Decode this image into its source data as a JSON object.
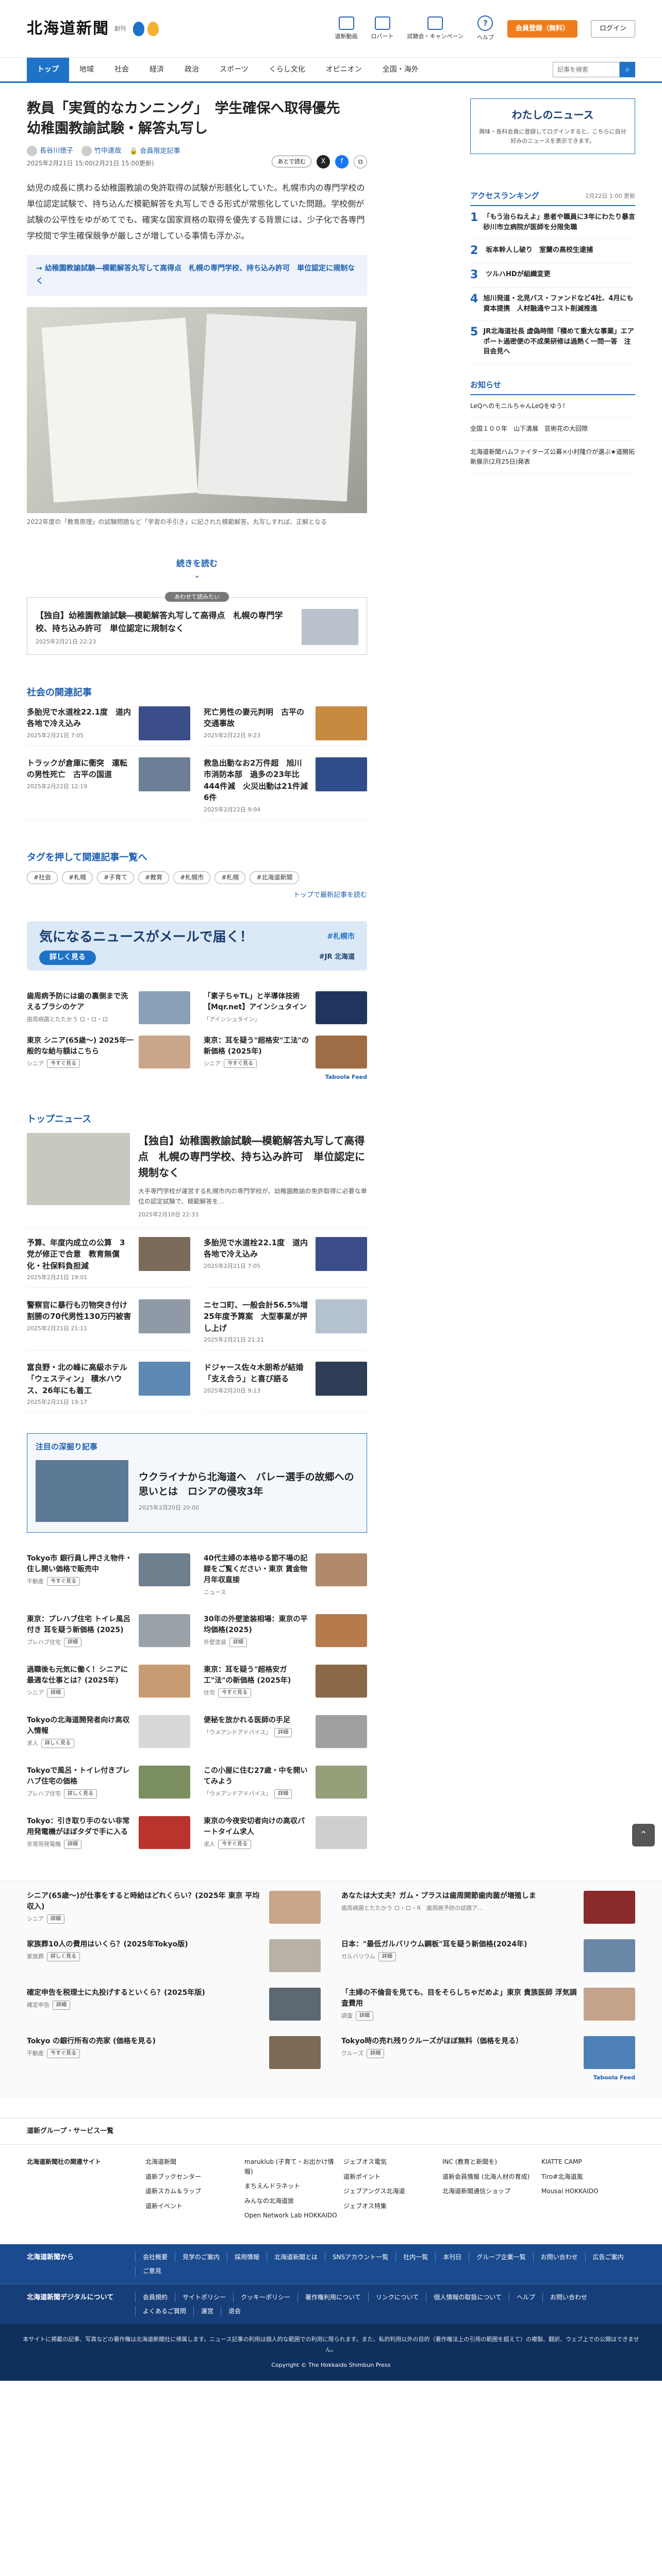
{
  "header": {
    "logo": "北海道新聞",
    "logo_sub": "創刊",
    "icons": [
      "道新動画",
      "ロバート",
      "試聴会・キャンペーン",
      "ヘルプ"
    ],
    "register": "会員登録（無料）",
    "login": "ログイン"
  },
  "nav": {
    "items": [
      "トップ",
      "地域",
      "社会",
      "経済",
      "政治",
      "スポーツ",
      "くらし文化",
      "オピニオン",
      "全国・海外"
    ],
    "search_placeholder": "記事を検索"
  },
  "article": {
    "title": "教員「実質的なカンニング」　学生確保へ取得優先　幼稚園教諭試験・解答丸写し",
    "authors": [
      "長谷川徳子",
      "竹中達哉"
    ],
    "dept": "会員限定記事",
    "dates": "2025年2月21日 15:00(2月21日 15:00更新)",
    "share_label": "あとで読む",
    "lead": "幼児の成長に携わる幼稚園教諭の免許取得の試験が形骸化していた。札幌市内の専門学校の単位認定試験で、持ち込んだ模範解答を丸写しできる形式が常態化していた問題。学校側が試験の公平性をゆがめてでも、確実な国家資格の取得を優先する背景には、少子化で各専門学校間で学生確保競争が厳しさが増している事情も浮かぶ。",
    "related": "→ 幼稚園教諭試験―模範解答丸写して高得点　札幌の専門学校、持ち込み許可　単位認定に規制なく",
    "caption": "2022年度の「教育原理」の試験問題など「学習の手引き」に記された模範解答。丸写しすれば、正解となる",
    "more": "続きを読む",
    "pickup_tag": "あわせて読みたい",
    "pickup_title": "【独自】幼稚園教諭試験―模範解答丸写して高得点　札幌の専門学校、持ち込み許可　単位認定に規制なく",
    "pickup_date": "2025年2月21日 22:23"
  },
  "social": {
    "heading": "社会の関連記事",
    "items": [
      {
        "t": "多胎児で水道栓22.1度　道内各地で冷え込み",
        "d": "2025年2月21日 7:05"
      },
      {
        "t": "死亡男性の妻元判明　古平の交通事故",
        "d": "2025年2月22日 9:23"
      },
      {
        "t": "トラックが倉庫に衝突　運転の男性死亡　古平の国道",
        "d": "2025年2月22日 12:19"
      },
      {
        "t": "救急出動なお2万件超　旭川市消防本部　過多の23年比444件減　火災出動は21件減6件",
        "d": "2025年2月22日 9:04"
      }
    ]
  },
  "tags": {
    "heading": "タグを押して関連記事一覧へ",
    "items": [
      "#社会",
      "#札幌",
      "#子育て",
      "#教育",
      "#札幌市",
      "#札幌",
      "#北海道新聞"
    ],
    "link": "トップで最新記事を読む"
  },
  "mail": {
    "title": "気になるニュースがメールで届く！",
    "button": "詳しく見る",
    "tag": "#札幌市",
    "tag2": "#JR 北海道"
  },
  "ads1": [
    {
      "t": "歯周病予防には歯の裏側まで洗えるブラシのケア",
      "s": "歯周病菌とたたかう ロ・ロ・ロ"
    },
    {
      "t": "「素子ちゃTL」と半導体技術【Mqr.net】アインシュタイン",
      "s": "「アインシュタイン」 "
    },
    {
      "t": "東京 シニア(65歳～) 2025年一般的な給与額はこちら",
      "s": "シニア",
      "pb": "今すぐ見る"
    },
    {
      "t": "東京：耳を疑う\"超格安\"工法\"の新価格 (2025年)",
      "s": "シニア",
      "pb": "今すぐ見る"
    }
  ],
  "taboola": "Taboola Feed",
  "top": {
    "heading": "トップニュース",
    "big_title": "【独自】幼稚園教諭試験―模範解答丸写して高得点　札幌の専門学校、持ち込み許可　単位認定に規制なく",
    "big_text": "大手専門学校が運営する札幌市内の専門学校が、幼稚園教諭の免許取得に必要な単位の認定試験で、模範解答を...",
    "big_date": "2025年2月18日 22:33",
    "items": [
      {
        "t": "予算、年度内成立の公算　3党が修正で合意　教育無償化・社保料負担減",
        "d": "2025年2月21日 19:01"
      },
      {
        "t": "多胎児で水道栓22.1度　道内各地で冷え込み",
        "d": "2025年2月21日 7:05"
      },
      {
        "t": "警察官に暴行も刃物突き付け　割勝の70代男性130万円被害",
        "d": "2025年2月21日 21:11"
      },
      {
        "t": "ニセコ町、一般会計56.5%増　25年度予算案　大型事業が押し上げ",
        "d": "2025年2月21日 21:21"
      },
      {
        "t": "富良野・北の峰に高級ホテル「ウェスティン」 積水ハウス、26年にも着工",
        "d": "2025年2月21日 19:17"
      },
      {
        "t": "ドジャース佐々木朗希が結婚「支え合う」と喜び語る",
        "d": "2025年2月20日 9:13"
      }
    ]
  },
  "deep": {
    "heading": "注目の深掘り記事",
    "title": "ウクライナから北海道へ　バレー選手の故郷への思いとは　ロシアの侵攻3年",
    "date": "2025年2月20日 20:00"
  },
  "ads2": [
    {
      "t": "Tokyo市 銀行員し押さえ物件・住し開い価格で販売中",
      "s": "不動産",
      "pb": "今すぐ見る"
    },
    {
      "t": "40代主婦の本格ゆる節不場の記録をご覧ください・東京 賃金物 月年収直接",
      "s": "ニュース"
    },
    {
      "t": "東京：プレハブ住宅 トイレ風呂 付き 耳を疑う新価格 (2025)",
      "s": "プレハブ住宅",
      "pb": "詳細"
    },
    {
      "t": "30年の外壁塗装相場：東京の平均価格(2025)",
      "s": "外壁塗装",
      "pb": "詳細"
    },
    {
      "t": "過職後も元気に働く！シニアに最適な仕事とは？(2025年)",
      "s": "シニア",
      "pb": "詳細"
    },
    {
      "t": "東京：耳を疑う\"超格安ガ工\"法\"の新価格 (2025年)",
      "s": "住宅",
      "pb": "今すぐ見る"
    },
    {
      "t": "Tokyoの北海道開発者向け高収入情報",
      "s": "求人",
      "pb": "詳しく見る"
    },
    {
      "t": "便秘を放かれる医師の手足",
      "s": "「ウメアンドアドバイス」",
      "pb": "詳細"
    },
    {
      "t": "Tokyoで風呂・トイレ付きプレハブ住宅の価格",
      "s": "プレハブ住宅",
      "pb": "詳しく見る"
    },
    {
      "t": "この小屋に住む27歳・中を開いてみよう",
      "s": "「ウメアンドアドバイス」",
      "pb": "詳細"
    },
    {
      "t": "Tokyo：引き取り手のない非常用発電機がほぼタダで手に入る",
      "s": "非常用発電機",
      "pb": "詳細"
    },
    {
      "t": "東京の今夜安切者向けの高収パートタイム求人",
      "s": "求人",
      "pb": "今すぐ見る"
    }
  ],
  "sidebar": {
    "box_title": "わたしのニュース",
    "box_text": "興味・各科会員に登録してログインすると、こちらに自分好みのニュースを表示できます。",
    "rank_heading": "アクセスランキング",
    "rank_updated": "2月22日 1:00 更新",
    "rank": [
      "「もう治らねえよ」患者や職員に3年にわたり暴言　砂川市立病院が医師を分限免職",
      "坂本幹人し破り　室蘭の高校生逮捕",
      "ツルハHDが組織変更",
      "旭川発道・北見バス・ファンドなど4社、4月にも資本提携　人材融通やコスト削減推進",
      "JR北海道社長 虚偽時間「積めて重大な事業」エアポート過密便の不成果研修は過熱く一問一答　注目会見へ"
    ],
    "notice_heading": "お知らせ",
    "notice": [
      "LeQへのモニルちゃんLeQをゆう！",
      "全国１００年　山下清展　芸術花の大回際",
      "北海道新聞ハムファイターズ公募×小村隆介が選ぶ★道開拓新展示(2月25日)発表"
    ]
  },
  "ads3": [
    {
      "t": "シニア(65歳～)が仕事をすると時給はどれくらい？(2025年 東京 平均収入)",
      "s": "シニア",
      "pb": "詳細"
    },
    {
      "t": "あなたは大丈夫？ガム・プラスは歯周関節歯肉菌が増殖しま",
      "s": "歯周病菌とたたかう ロ・ロ・R　歯周病予防の話題ア..."
    },
    {
      "t": "家族葬10人の費用はいくら？(2025年Tokyo版)",
      "s": "家族葬",
      "pb": "詳しく見る"
    },
    {
      "t": "日本：\"最低ガルバリウム鋼板\"耳を疑う新価格(2024年)",
      "s": "ガルバリウム",
      "pb": "詳細"
    },
    {
      "t": "確定申告を税理士に丸投げするといくら？(2025年版)",
      "s": "確定申告",
      "pb": "詳細"
    },
    {
      "t": "「主婦の不倫音を見ても、目をそらしちゃだめよ」東京 貴族医師 浮気調査費用",
      "s": "調査",
      "pb": "詳細"
    },
    {
      "t": "Tokyo の銀行所有の売家 (価格を見る)",
      "s": "不動産",
      "pb": "今すぐ見る"
    },
    {
      "t": "Tokyo時の売れ残りクルーズがほぼ無料（価格を見る）",
      "s": "クルーズ",
      "pb": "詳細"
    }
  ],
  "footer": {
    "group": "道新グループ・サービス一覧",
    "sites_heading": "北海道新聞社の関連サイト",
    "sites": [
      [
        "北海道新聞",
        "道新ブックセンター",
        "道新スカム＆ラップ",
        "道新イベント"
      ],
      [
        "maruklub (子育て・お出かけ情報)",
        "まちえんドラネット",
        "みんなの北海道旅",
        "Open Network Lab HOKKAIDO"
      ],
      [
        "ジェブオス電気",
        "道新ポイント",
        "ジェブアングス北海道",
        "ジェブオス特集"
      ],
      [
        "INC (教育と新聞を)",
        "道新会員情報 (北海人材の育成)",
        "北海道新聞通信ショップ"
      ],
      [
        "KIATTE CAMP",
        "Tiro#北海道風",
        "Mousai HOKKAIDO"
      ]
    ],
    "bar1_heading": "北海道新聞から",
    "bar1": [
      "会社概要",
      "見学のご案内",
      "採用情報",
      "北海道新聞とは",
      "SNSアカウント一覧",
      "社内一覧",
      "本刊日",
      "グループ企業一覧",
      "お問い合わせ",
      "広告ご案内",
      "ご意見"
    ],
    "bar2_heading": "北海道新聞デジタルについて",
    "bar2": [
      "会員規約",
      "サイトポリシー",
      "クッキーポリシー",
      "著作権利用について",
      "リンクについて",
      "個人情報の取扱について",
      "ヘルプ",
      "お問い合わせ",
      "よくあるご質問",
      "運営",
      "退会"
    ],
    "legal": "本サイトに掲載の記事、写真などの著作権は北海道新聞社に帰属します。ニュース記事の利用は個人的な範囲での利用に限られます。また、私的利用以外の目的（著作権法上の引用の範囲を超えて）の複製、翻訳、ウェブ上での公開はできません。",
    "copyright": "Copyright © The Hokkaido Shimbun Press"
  },
  "colors": {
    "accent": "#1e73c8",
    "register": "#f07d1b",
    "footer": "#1b4b8f"
  }
}
